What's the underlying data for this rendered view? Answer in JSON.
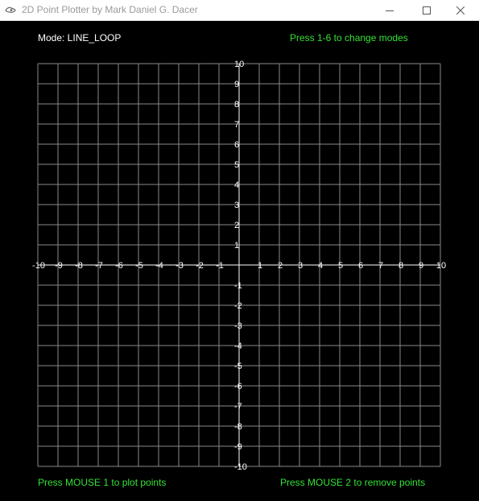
{
  "window": {
    "title": "2D Point Plotter by Mark Daniel G. Dacer",
    "icon": "app-icon",
    "controls": {
      "minimize_icon": "minimize-icon",
      "maximize_icon": "maximize-icon",
      "close_icon": "close-icon"
    }
  },
  "header": {
    "mode_text": "Mode: LINE_LOOP",
    "modes_hint": "Press 1-6 to change modes"
  },
  "footer": {
    "plot_hint": "Press MOUSE 1 to plot points",
    "remove_hint": "Press MOUSE 2 to remove points"
  },
  "colors": {
    "background": "#000000",
    "grid": "#8a8a8a",
    "axis": "#ffffff",
    "hint_text": "#34e234",
    "mode_text": "#ffffff"
  },
  "grid": {
    "x_range": [
      -10,
      10
    ],
    "y_range": [
      -10,
      10
    ],
    "step": 1,
    "x_tick_labels": [
      "-10",
      "-9",
      "-8",
      "-7",
      "-6",
      "-5",
      "-4",
      "-3",
      "-2",
      "-1",
      "1",
      "2",
      "3",
      "4",
      "5",
      "6",
      "7",
      "8",
      "9",
      "10"
    ],
    "y_tick_labels": [
      "10",
      "9",
      "8",
      "7",
      "6",
      "5",
      "4",
      "3",
      "2",
      "1",
      "-1",
      "-2",
      "-3",
      "-4",
      "-5",
      "-6",
      "-7",
      "-8",
      "-9",
      "-10"
    ]
  }
}
